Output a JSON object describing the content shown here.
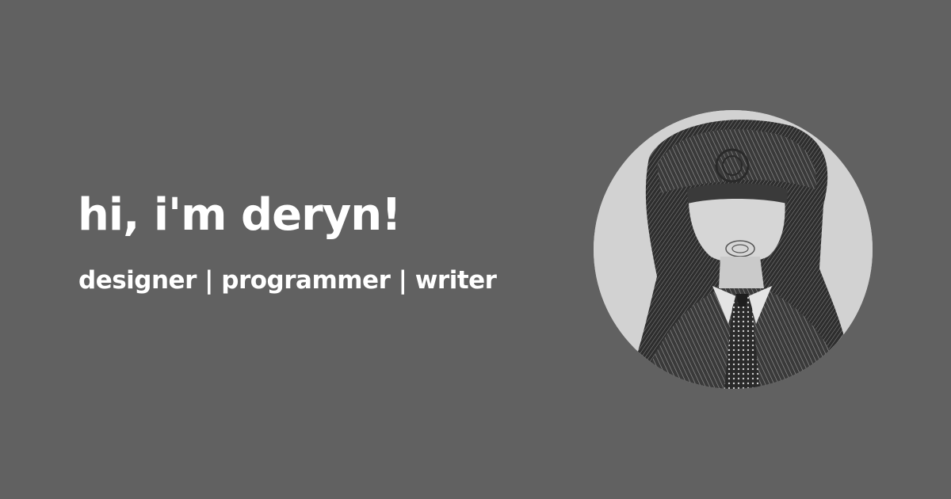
{
  "hero": {
    "heading": "hi, i'm deryn!",
    "tagline": "designer | programmer | writer"
  },
  "colors": {
    "background": "#616161",
    "text": "#ffffff",
    "portrait_light": "#d2d2d2",
    "portrait_dark": "#2b2b2b"
  },
  "portrait": {
    "icon": "portrait-photo"
  }
}
